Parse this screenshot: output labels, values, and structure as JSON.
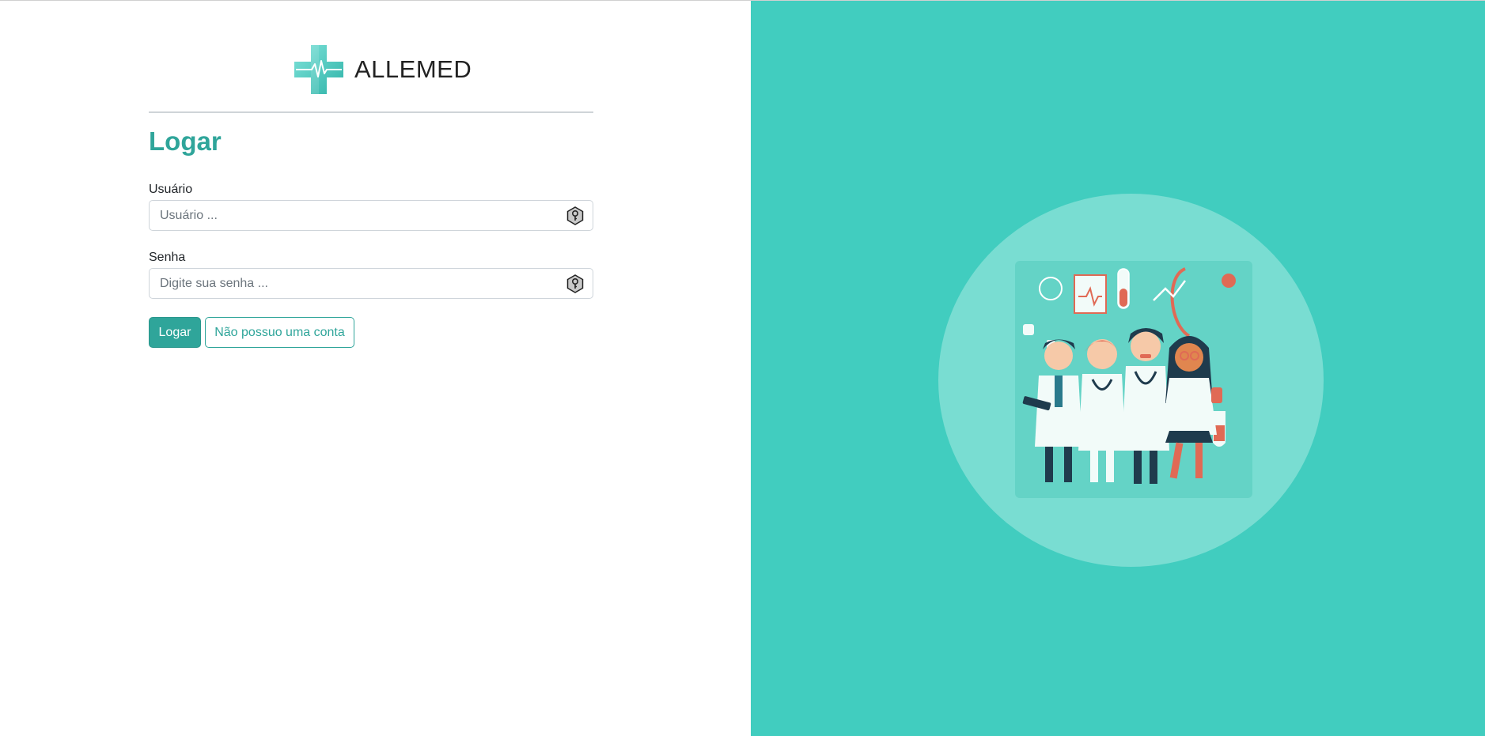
{
  "brand": {
    "name": "ALLEMED",
    "logo_icon": "medical-cross-heartbeat-icon"
  },
  "login": {
    "title": "Logar",
    "username": {
      "label": "Usuário",
      "placeholder": "Usuário ...",
      "value": "",
      "icon": "key-hexagon-icon"
    },
    "password": {
      "label": "Senha",
      "placeholder": "Digite sua senha ...",
      "value": "",
      "icon": "key-hexagon-icon"
    },
    "submit_label": "Logar",
    "no_account_label": "Não possuo uma conta"
  },
  "hero": {
    "illustration": "doctors-team-illustration"
  },
  "colors": {
    "accent": "#2fa59a",
    "panel": "#41cdbf",
    "circle": "#79ddd2"
  }
}
